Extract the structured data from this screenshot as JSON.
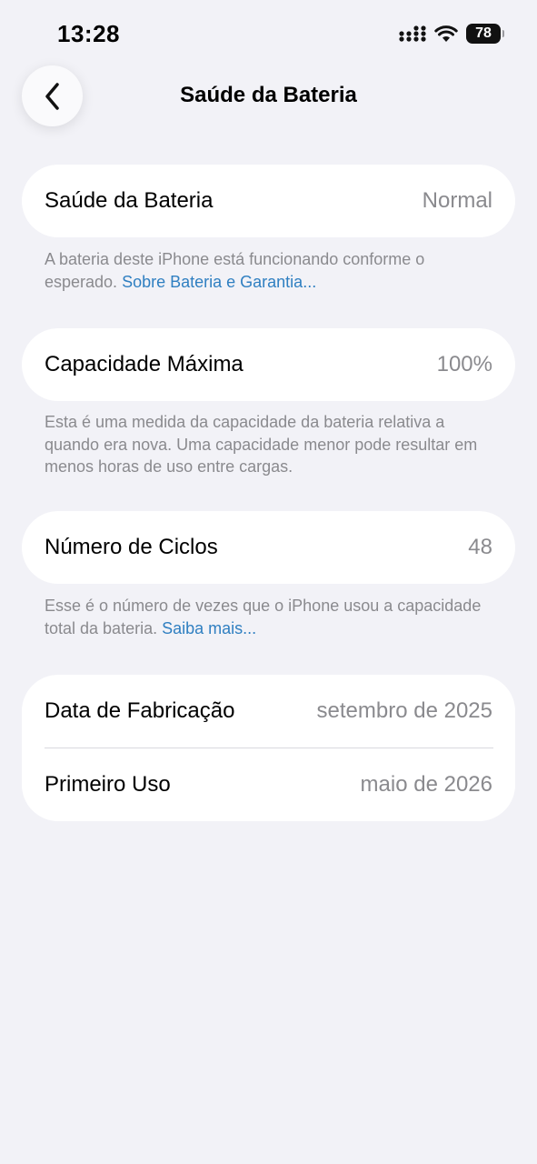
{
  "status_bar": {
    "time": "13:28",
    "battery_level": "78",
    "icons": [
      "cellular-signal-icon",
      "wifi-icon",
      "battery-icon"
    ]
  },
  "nav": {
    "back_icon": "chevron-left-icon",
    "title": "Saúde da Bateria"
  },
  "battery_health": {
    "label": "Saúde da Bateria",
    "value": "Normal",
    "footnote": "A bateria deste iPhone está funcionando conforme o esperado.",
    "link": "Sobre Bateria e Garantia..."
  },
  "max_capacity": {
    "label": "Capacidade Máxima",
    "value": "100%",
    "footnote": "Esta é uma medida da capacidade da bateria relativa a quando era nova. Uma capacidade menor pode resultar em menos horas de uso entre cargas."
  },
  "cycle_count": {
    "label": "Número de Ciclos",
    "value": "48",
    "footnote": "Esse é o número de vezes que o iPhone usou a capacidade total da bateria.",
    "link": "Saiba mais..."
  },
  "dates": {
    "manufacture_label": "Data de Fabricação",
    "manufacture_value": "setembro de 2025",
    "first_use_label": "Primeiro Uso",
    "first_use_value": "maio de 2026"
  },
  "colors": {
    "background": "#f2f2f7",
    "card": "#ffffff",
    "secondary_text": "#8a8a8e",
    "link": "#2f7fc1"
  }
}
